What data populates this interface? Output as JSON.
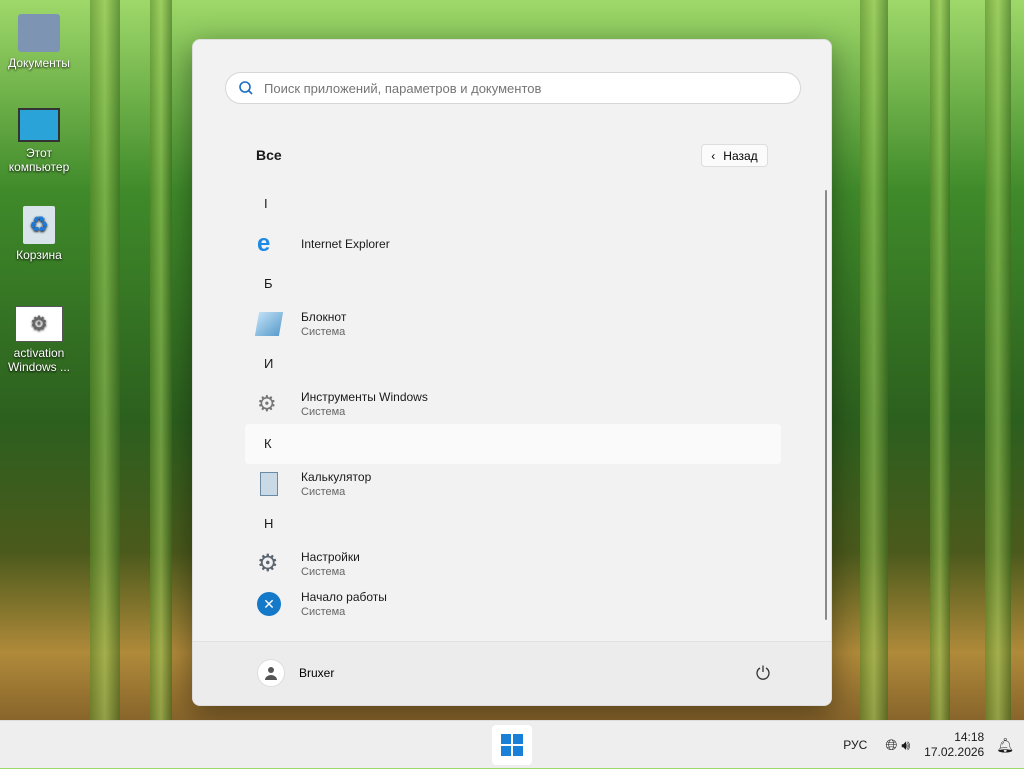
{
  "desktop": {
    "icons": [
      {
        "label": "Документы"
      },
      {
        "label": "Этот компьютер"
      },
      {
        "label": "Корзина"
      },
      {
        "label": "activation Windows ..."
      }
    ]
  },
  "start_menu": {
    "search": {
      "placeholder": "Поиск приложений, параметров и документов"
    },
    "section_title": "Все",
    "back_label": "Назад",
    "groups": [
      {
        "letter": "I",
        "apps": [
          {
            "name": "Internet Explorer",
            "sub": ""
          }
        ]
      },
      {
        "letter": "Б",
        "apps": [
          {
            "name": "Блокнот",
            "sub": "Система"
          }
        ]
      },
      {
        "letter": "И",
        "apps": [
          {
            "name": "Инструменты Windows",
            "sub": "Система"
          }
        ]
      },
      {
        "letter": "К",
        "apps": [
          {
            "name": "Калькулятор",
            "sub": "Система"
          }
        ]
      },
      {
        "letter": "Н",
        "apps": [
          {
            "name": "Настройки",
            "sub": "Система"
          },
          {
            "name": "Начало работы",
            "sub": "Система"
          }
        ]
      }
    ],
    "user": {
      "name": "Bruxer"
    }
  },
  "taskbar": {
    "language": "РУС",
    "time": "14:18",
    "date": "17.02.2026"
  }
}
